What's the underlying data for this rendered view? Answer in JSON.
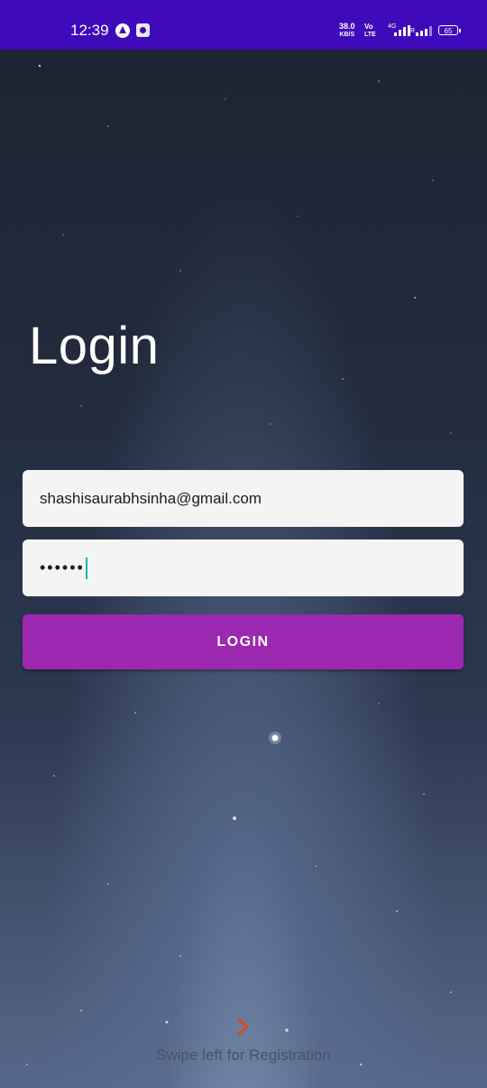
{
  "status_bar": {
    "time": "12:39",
    "net_speed_value": "38.0",
    "net_speed_unit": "KB/S",
    "volte_top": "Vo",
    "volte_bottom": "LTE",
    "net_type": "4G",
    "roaming": "R",
    "battery": "65",
    "icons": [
      "app-a-icon",
      "camera-app-icon",
      "signal-icon",
      "battery-icon"
    ]
  },
  "login": {
    "title": "Login",
    "email_value": "shashisaurabhsinha@gmail.com",
    "password_value": "••••••",
    "button_label": "LOGIN"
  },
  "footer": {
    "swipe_hint": "Swipe left for Registration",
    "chevron_icon": "chevron-right-icon"
  },
  "colors": {
    "status_bar": "#3f0aba",
    "button": "#9c27b0",
    "field_bg": "#f4f4f4",
    "cursor": "#1ab0b8",
    "chevron": "#e0452c"
  }
}
